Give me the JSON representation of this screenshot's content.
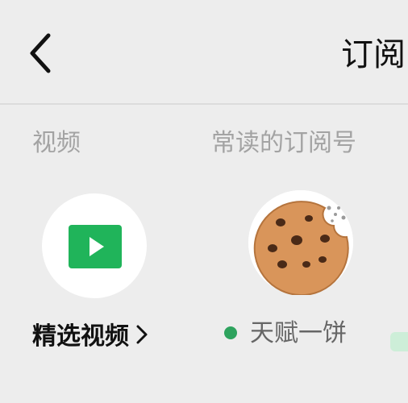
{
  "header": {
    "title": "订阅",
    "back_icon": "chevron-left-icon"
  },
  "sections": {
    "video_label": "视频",
    "frequent_label": "常读的订阅号"
  },
  "video_item": {
    "label": "精选视频",
    "icon": "play-video-icon",
    "chevron_icon": "chevron-right-icon"
  },
  "frequent_item": {
    "name": "天赋一饼",
    "avatar": "cookie-avatar",
    "status_color": "#2ea35e"
  },
  "colors": {
    "background": "#ededed",
    "accent_green": "#20b45a",
    "status_dot": "#2ea35e"
  }
}
